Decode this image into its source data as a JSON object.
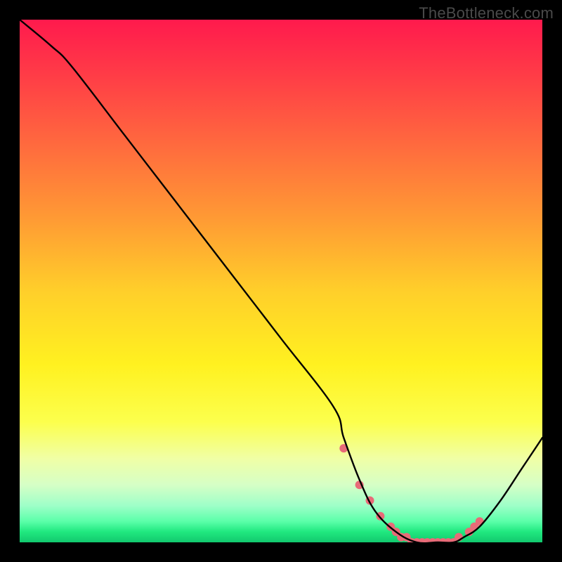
{
  "watermark": "TheBottleneck.com",
  "chart_data": {
    "type": "line",
    "title": "",
    "xlabel": "",
    "ylabel": "",
    "xlim": [
      0,
      100
    ],
    "ylim": [
      0,
      100
    ],
    "grid": false,
    "legend": false,
    "series": [
      {
        "name": "bottleneck-curve",
        "color": "#000000",
        "x": [
          0,
          6,
          10,
          20,
          30,
          40,
          50,
          60,
          62,
          65,
          68,
          72,
          76,
          80,
          83,
          85,
          88,
          92,
          96,
          100
        ],
        "y": [
          100,
          95,
          91,
          78,
          65,
          52,
          39,
          26,
          20,
          12,
          6,
          2,
          0,
          0,
          0,
          1,
          3,
          8,
          14,
          20
        ]
      }
    ],
    "markers": {
      "name": "highlight-dots",
      "color": "#e86b78",
      "radius_px": 6,
      "x": [
        62,
        65,
        67,
        69,
        71,
        72,
        73,
        74,
        75,
        76,
        77,
        78,
        79,
        80,
        81,
        82,
        83,
        84,
        86,
        87,
        88
      ],
      "y": [
        18,
        11,
        8,
        5,
        3,
        2,
        1,
        1,
        0,
        0,
        0,
        0,
        0,
        0,
        0,
        0,
        0,
        1,
        2,
        3,
        4
      ]
    },
    "background_gradient": {
      "orientation": "vertical",
      "stops": [
        {
          "pos": 0.0,
          "color": "#ff1a4d"
        },
        {
          "pos": 0.1,
          "color": "#ff3a47"
        },
        {
          "pos": 0.24,
          "color": "#ff6a3e"
        },
        {
          "pos": 0.38,
          "color": "#ff9a34"
        },
        {
          "pos": 0.52,
          "color": "#ffcf2a"
        },
        {
          "pos": 0.66,
          "color": "#fff120"
        },
        {
          "pos": 0.77,
          "color": "#fcff4d"
        },
        {
          "pos": 0.84,
          "color": "#f0ffa6"
        },
        {
          "pos": 0.89,
          "color": "#d6ffc6"
        },
        {
          "pos": 0.93,
          "color": "#9effc8"
        },
        {
          "pos": 0.96,
          "color": "#5bffa9"
        },
        {
          "pos": 0.98,
          "color": "#20e87f"
        },
        {
          "pos": 1.0,
          "color": "#12c96e"
        }
      ]
    }
  }
}
